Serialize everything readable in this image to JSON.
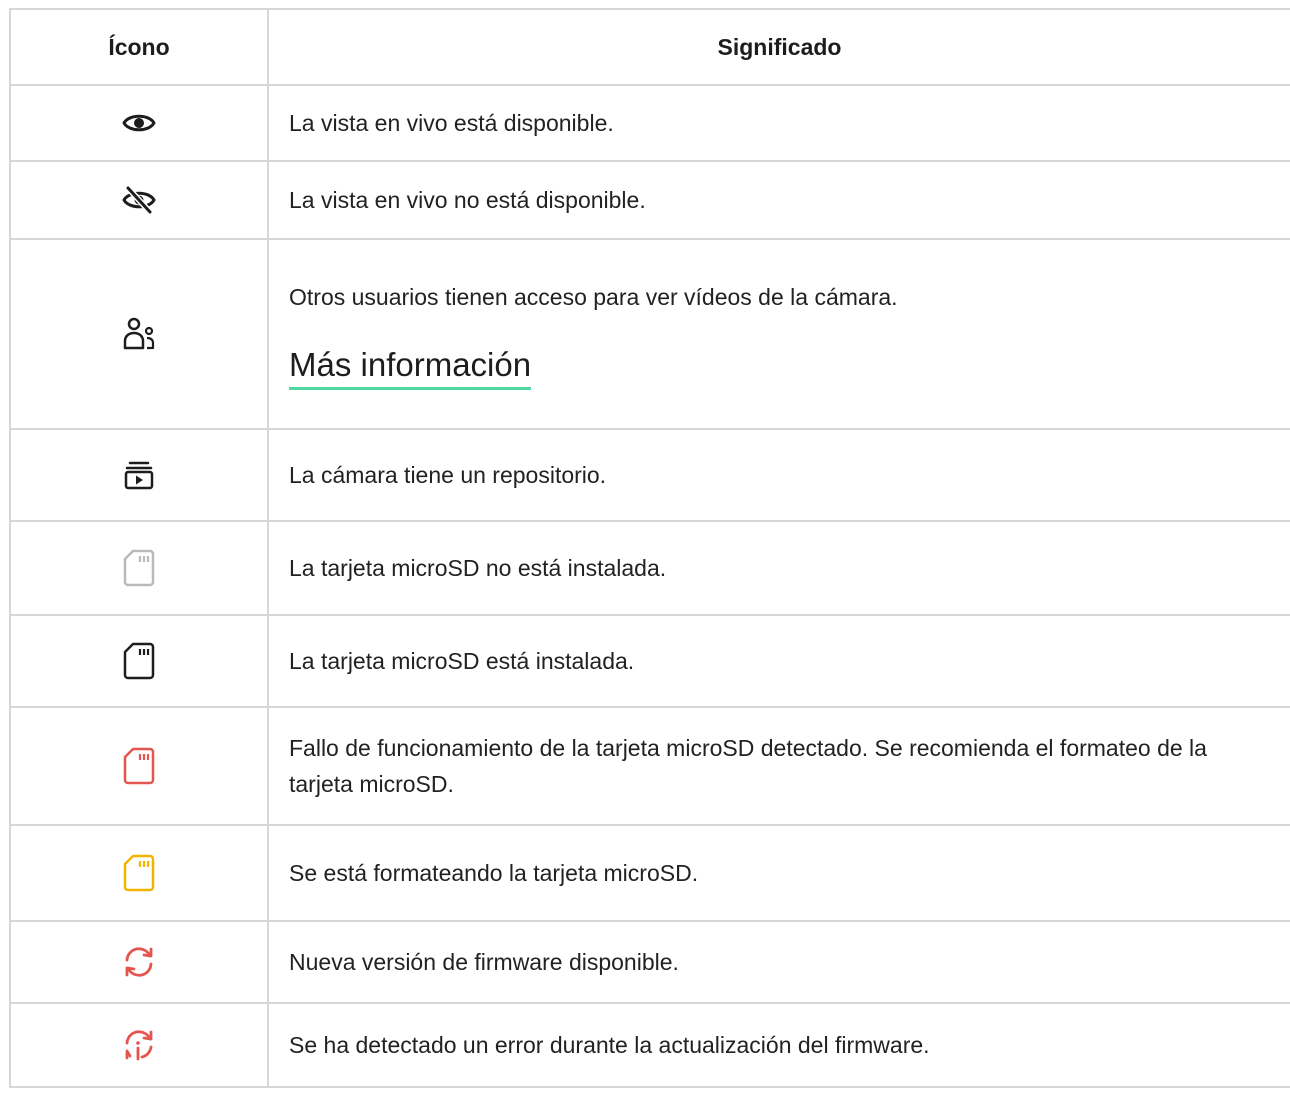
{
  "table": {
    "headers": {
      "icon": "Ícono",
      "meaning": "Significado"
    },
    "rows": [
      {
        "icon": "eye-icon",
        "text": "La vista en vivo está disponible."
      },
      {
        "icon": "eye-off-icon",
        "text": "La vista en vivo no está disponible."
      },
      {
        "icon": "users-icon",
        "text": "Otros usuarios tienen acceso para ver vídeos de la cámara.",
        "link": "Más información"
      },
      {
        "icon": "archive-play-icon",
        "text": "La cámara tiene un repositorio."
      },
      {
        "icon": "sd-card-icon",
        "color": "#b9b9b9",
        "text": "La tarjeta microSD no está instalada."
      },
      {
        "icon": "sd-card-icon",
        "color": "#1d1d1f",
        "text": "La tarjeta microSD está instalada."
      },
      {
        "icon": "sd-card-icon",
        "color": "#e5554f",
        "text": "Fallo de funcionamiento de la tarjeta microSD detectado. Se recomienda el formateo de la tarjeta microSD."
      },
      {
        "icon": "sd-card-icon",
        "color": "#f2b400",
        "text": "Se está formateando la tarjeta microSD."
      },
      {
        "icon": "refresh-icon",
        "color": "#e5554f",
        "text": "Nueva versión de firmware disponible."
      },
      {
        "icon": "refresh-info-icon",
        "color": "#e5554f",
        "text": "Se ha detectado un error durante la actualización del firmware."
      }
    ]
  }
}
